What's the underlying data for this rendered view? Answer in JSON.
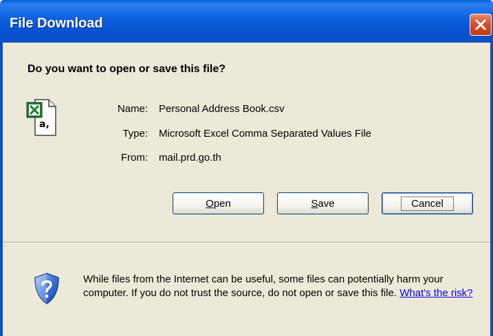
{
  "window": {
    "title": "File Download"
  },
  "dialog": {
    "question": "Do you want to open or save this file?",
    "file_icon_label": "a,",
    "info": [
      {
        "label": "Name:",
        "value": "Personal Address Book.csv"
      },
      {
        "label": "Type:",
        "value": "Microsoft Excel Comma Separated Values File"
      },
      {
        "label": "From:",
        "value": "mail.prd.go.th"
      }
    ]
  },
  "buttons": {
    "open": {
      "mnemonic": "O",
      "rest": "pen"
    },
    "save": {
      "mnemonic": "S",
      "rest": "ave"
    },
    "cancel": {
      "label": "Cancel"
    }
  },
  "warning": {
    "text": "While files from the Internet can be useful, some files can potentially harm your computer. If you do not trust the source, do not open or save this file.",
    "link": "What's the risk?"
  },
  "colors": {
    "titlebar_blue": "#0a5fd8",
    "dialog_background": "#ece9d8",
    "close_button_red": "#d8502a",
    "link_blue": "#0000ee"
  },
  "icons": [
    "close-icon",
    "excel-csv-file-icon",
    "security-shield-icon"
  ]
}
